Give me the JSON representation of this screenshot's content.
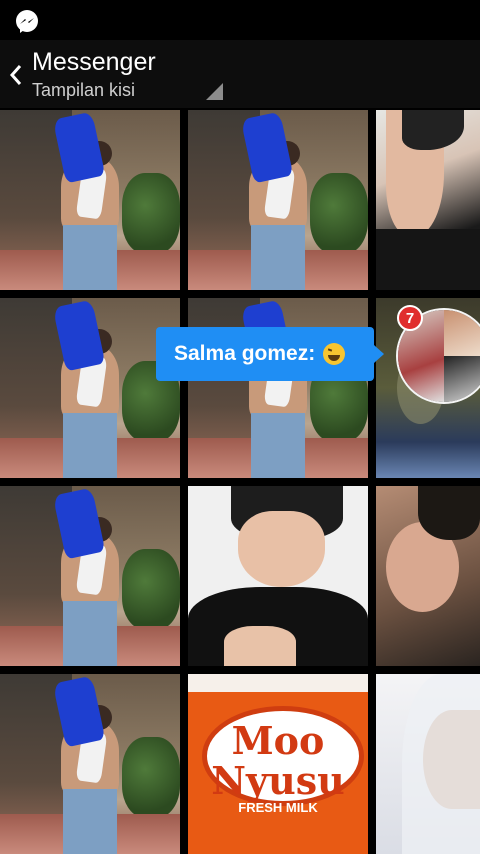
{
  "header": {
    "title": "Messenger",
    "subtitle": "Tampilan kisi"
  },
  "grid": {
    "tiles": [
      {
        "photo": "man-with-blue-jug"
      },
      {
        "photo": "man-with-blue-jug"
      },
      {
        "photo": "selfie-face"
      },
      {
        "photo": "man-with-blue-jug"
      },
      {
        "photo": "man-with-blue-jug"
      },
      {
        "photo": "dark-photo"
      },
      {
        "photo": "man-with-blue-jug"
      },
      {
        "photo": "selfie-smile-peace"
      },
      {
        "photo": "selfie-lying"
      },
      {
        "photo": "man-with-blue-jug"
      },
      {
        "photo": "moo-nyusu-bottle"
      },
      {
        "photo": "hooded-face"
      }
    ],
    "moo_brand": "Moo Nyusu",
    "moo_subtitle": "FRESH MILK"
  },
  "chat_head": {
    "message": "Salma gomez:",
    "emoji": "laughing-emoji",
    "unread_count": "7",
    "colors": {
      "bubble": "#1f8ef4",
      "badge": "#e02d2d"
    }
  }
}
